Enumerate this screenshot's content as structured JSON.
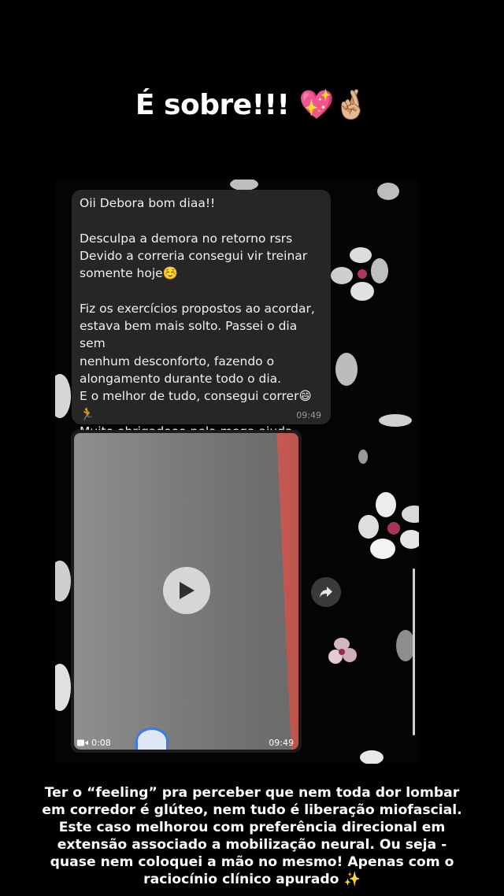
{
  "headline": {
    "text": "É sobre!!!",
    "emoji": "💖🤞🏼"
  },
  "message": {
    "text": "Oii Debora bom diaa!!\n\nDesculpa a demora no retorno rsrs\nDevido a correria consegui vir treinar\nsomente hoje☺️\n\nFiz os exercícios propostos ao acordar,\nestava bem mais solto. Passei o dia sem\nnenhum desconforto, fazendo o\nalongamento durante todo o dia.\nE o melhor de tudo, consegui correr😄\n🏃\nMuito obrigadooo pela mega ajuda",
    "time": "09:49"
  },
  "video": {
    "duration": "0:08",
    "time": "09:49",
    "icons": {
      "play": "play-icon",
      "camera": "video-camera-icon",
      "share": "forward-icon"
    }
  },
  "caption": {
    "lines": [
      "Ter o “feeling” pra perceber que nem toda dor lombar em corredor é glúteo, nem tudo é liberação miofascial.",
      "Este caso melhorou com preferência direcional em extensão associado a mobilização neural. Ou seja - quase nem coloquei a mão no mesmo! Apenas com o raciocínio clínico apurado ✨"
    ]
  },
  "colors": {
    "background": "#000000",
    "bubble": "#262627",
    "timestamp": "#9a9a9a"
  }
}
